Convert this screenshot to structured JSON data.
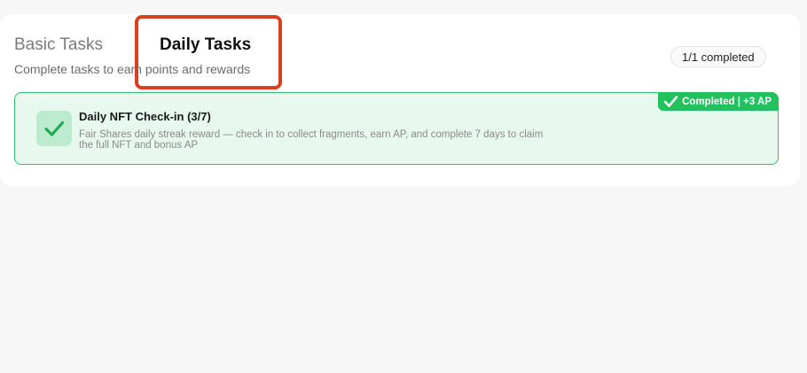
{
  "tabs": {
    "basic_label": "Basic Tasks",
    "daily_label": "Daily Tasks"
  },
  "header": {
    "subtitle": "Complete tasks to earn points and rewards",
    "progress": "1/1 completed"
  },
  "task": {
    "title": "Daily NFT Check-in (3/7)",
    "description": "Fair Shares daily streak reward — check in to collect fragments, earn AP, and complete 7 days to claim the full NFT and bonus AP",
    "status_badge": "Completed | +3 AP",
    "icon": "checkmark-icon"
  },
  "colors": {
    "accent_green": "#22c15e",
    "card_bg": "#e7f8ee",
    "highlight_red": "#d9411e"
  }
}
